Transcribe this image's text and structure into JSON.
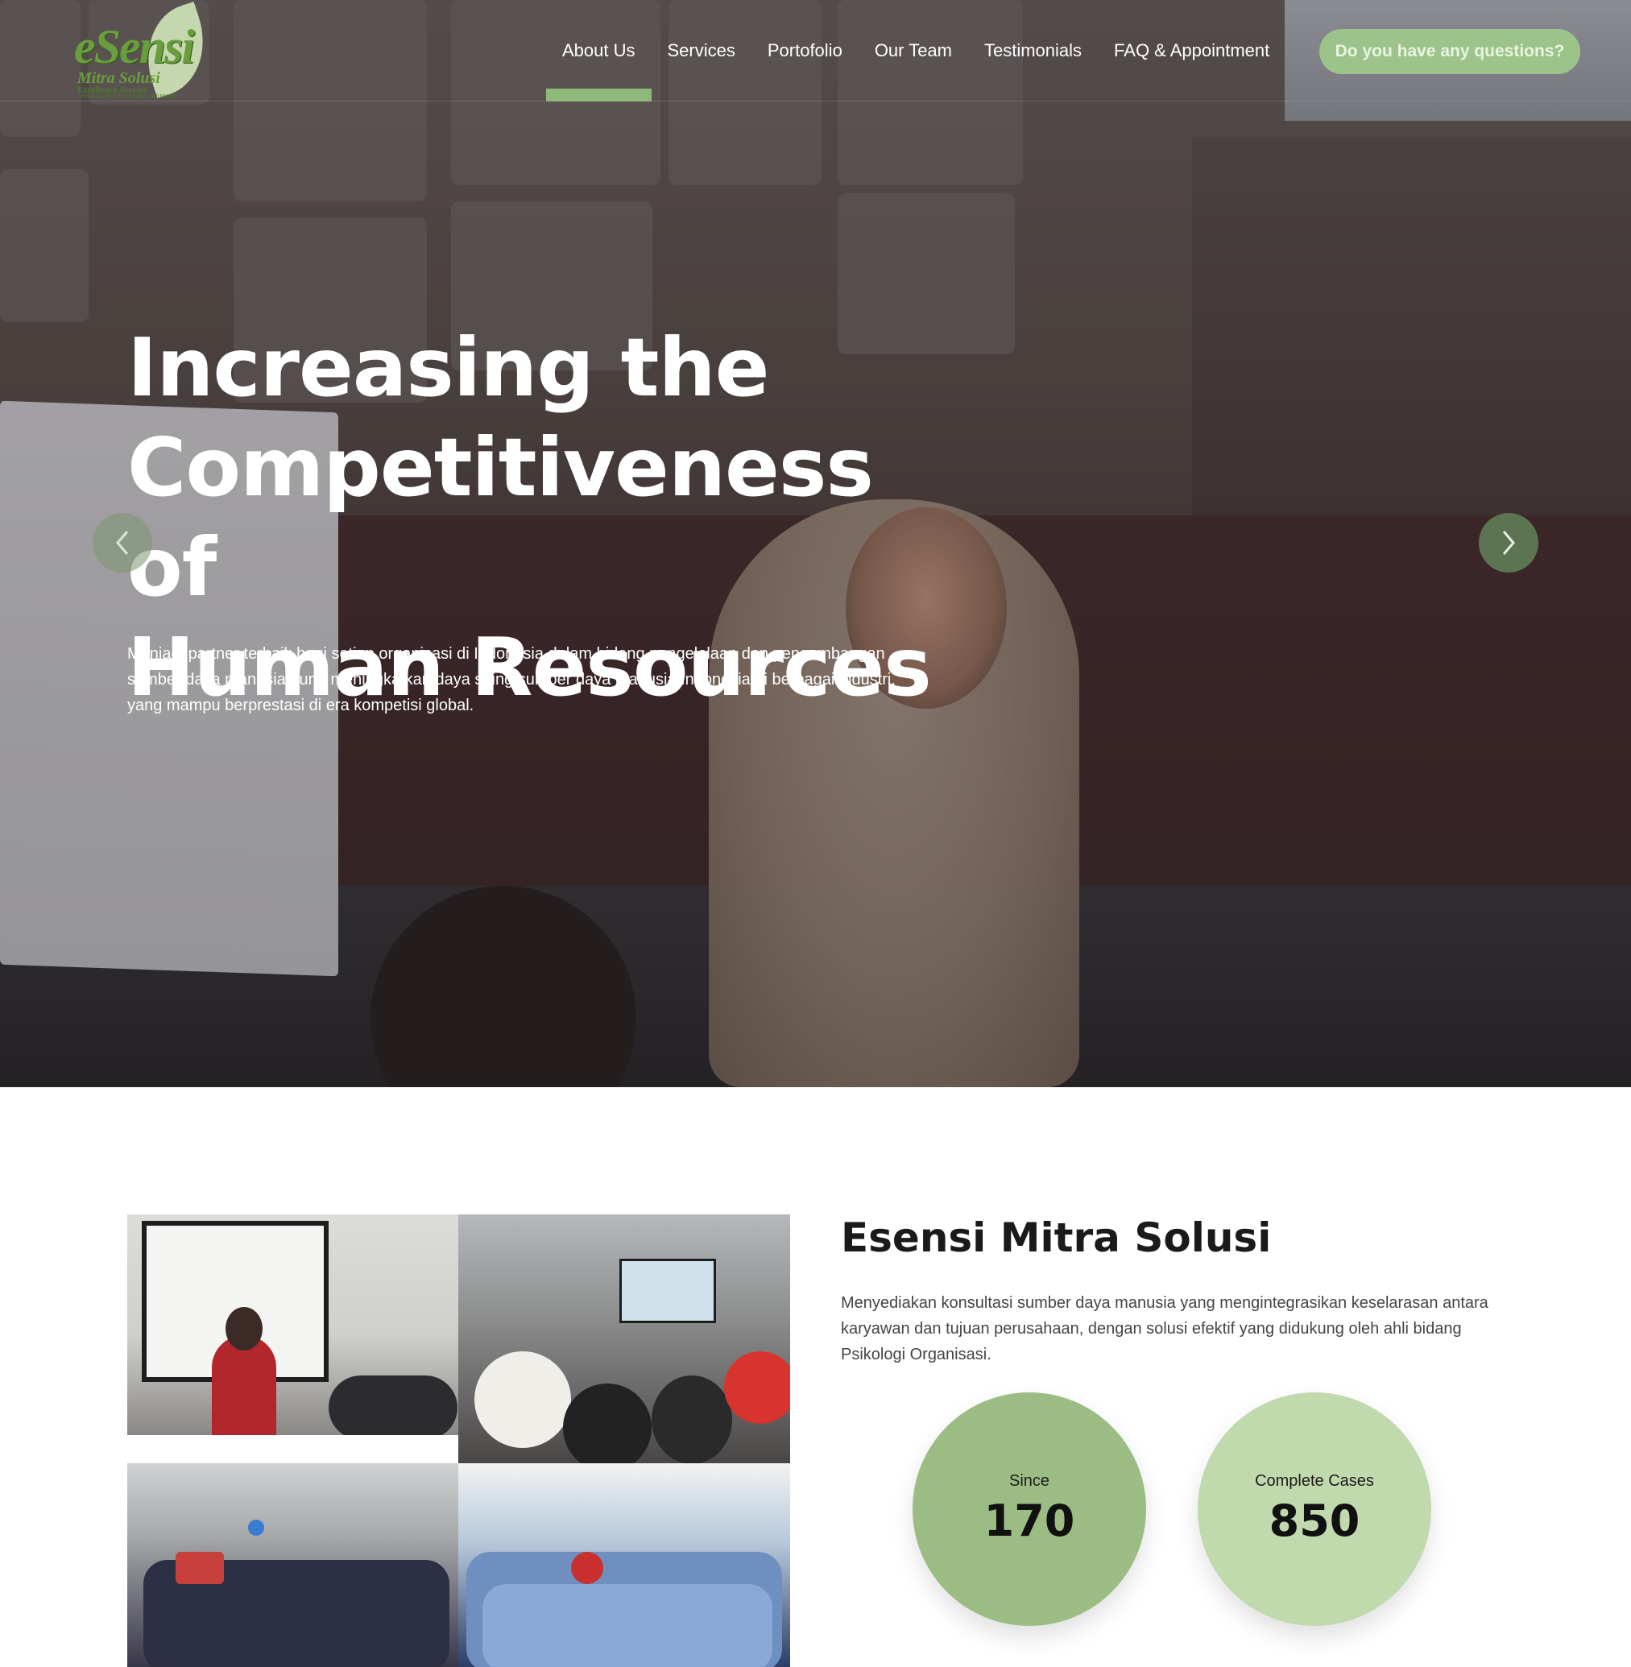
{
  "brand": {
    "logo_mark": "eSensi",
    "logo_line1": "Mitra Solusi",
    "logo_line2": "Excellence Service",
    "logo_line3": "to Encourage Number of Solution with Integrity",
    "accent_color": "#8fb97b"
  },
  "nav": {
    "items": [
      {
        "label": "About Us",
        "active": true
      },
      {
        "label": "Services",
        "active": false
      },
      {
        "label": "Portofolio",
        "active": false
      },
      {
        "label": "Our Team",
        "active": false
      },
      {
        "label": "Testimonials",
        "active": false
      },
      {
        "label": "FAQ & Appointment",
        "active": false
      }
    ],
    "cta_label": "Do you have any questions?"
  },
  "hero": {
    "title_lines": [
      "Increasing the",
      "Competitiveness of",
      "Human Resources"
    ],
    "description": "Menjadi partner terbaik bagi setiap organisasi di Indonesia dalam bidang pengelolaan dan pengembangan sumber daya manusia guna meningkatkan daya saing sumber daya manusia Indonesia di berbagai industri, yang mampu berprestasi di era kompetisi global.",
    "prev_icon": "chevron-left-icon",
    "next_icon": "chevron-right-icon"
  },
  "about": {
    "title": "Esensi Mitra Solusi",
    "description": "Menyediakan konsultasi sumber daya manusia yang mengintegrasikan keselarasan antara karyawan dan tujuan perusahaan, dengan solusi efektif yang didukung oleh ahli bidang Psikologi Organisasi.",
    "stats": [
      {
        "label": "Since",
        "value": "170",
        "color": "#9bbd84"
      },
      {
        "label": "Complete Cases",
        "value": "850",
        "color": "#c0d9ad"
      }
    ]
  }
}
